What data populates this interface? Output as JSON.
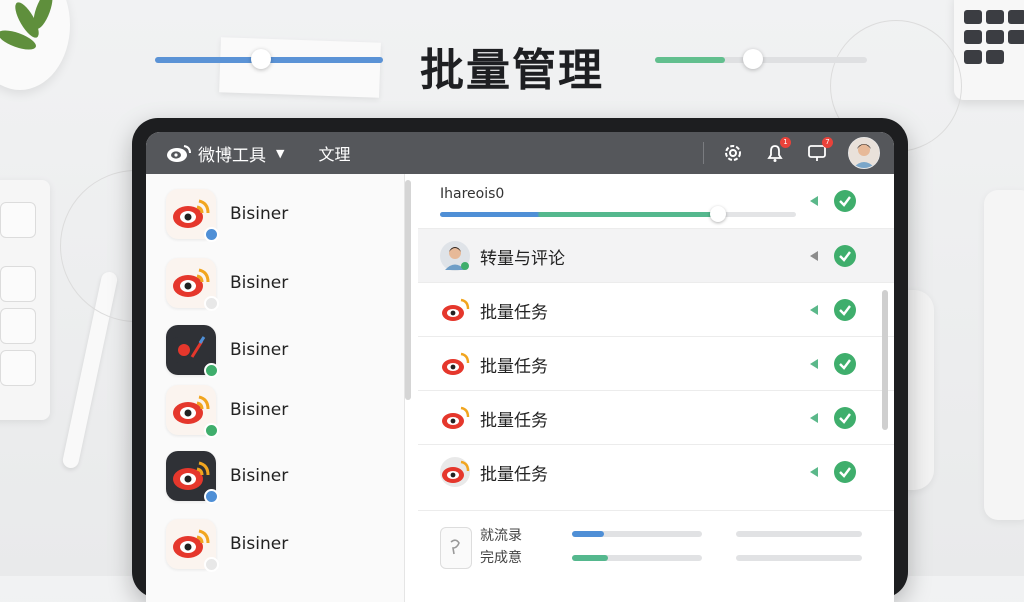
{
  "page": {
    "title": "批量管理"
  },
  "topbar": {
    "brand": "微博工具",
    "nav": "文理",
    "badges": {
      "notifications": "1",
      "messages": "7"
    }
  },
  "sidebar": {
    "accounts": [
      {
        "name": "Bisiner",
        "status": "verified"
      },
      {
        "name": "Bisiner",
        "status": "online"
      },
      {
        "name": "Bisiner",
        "status": "online"
      },
      {
        "name": "Bisiner",
        "status": "online"
      },
      {
        "name": "Bisiner",
        "status": "verified"
      },
      {
        "name": "Bisiner",
        "status": "online"
      }
    ]
  },
  "main": {
    "progress": {
      "label": "Ihareois0",
      "value": 0.78
    },
    "rows": [
      {
        "label": "转量与评论",
        "icon": "user-avatar-icon",
        "status": "complete"
      },
      {
        "label": "批量任务",
        "icon": "weibo-logo-icon",
        "status": "complete"
      },
      {
        "label": "批量任务",
        "icon": "weibo-logo-icon",
        "status": "complete"
      },
      {
        "label": "批量任务",
        "icon": "weibo-logo-icon",
        "status": "complete"
      },
      {
        "label": "批量任务",
        "icon": "weibo-logo-icon",
        "status": "complete"
      }
    ],
    "footer": {
      "line1": "就流录",
      "line2": "完成意"
    }
  },
  "colors": {
    "accent_blue": "#4f8fd6",
    "accent_green": "#55b88e",
    "check_green": "#3fae6c",
    "topbar": "#55575b"
  }
}
